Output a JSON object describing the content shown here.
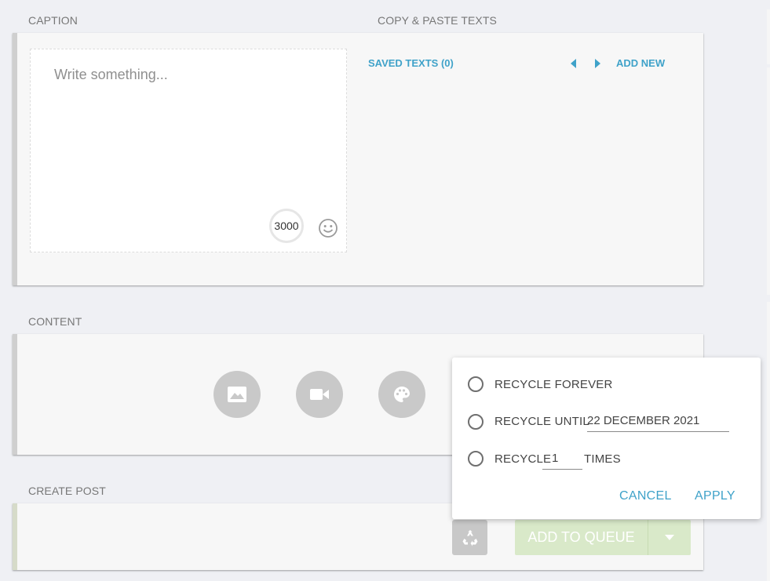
{
  "caption": {
    "section_label": "CAPTION",
    "placeholder": "Write something...",
    "char_count": "3000"
  },
  "copy_paste": {
    "section_label": "COPY & PASTE TEXTS",
    "saved_texts": "SAVED TEXTS (0)",
    "add_new": "ADD NEW"
  },
  "content": {
    "section_label": "CONTENT",
    "buttons": [
      "image-icon",
      "video-camera-icon",
      "palette-icon"
    ]
  },
  "create_post": {
    "section_label": "CREATE POST",
    "add_to_queue": "ADD TO QUEUE"
  },
  "recycle_popup": {
    "forever": "RECYCLE FOREVER",
    "until": "RECYCLE UNTIL",
    "until_date": "22 DECEMBER 2021",
    "times_prefix": "RECYCLE",
    "times_value": "1",
    "times_suffix": "TIMES",
    "cancel": "CANCEL",
    "apply": "APPLY"
  },
  "colors": {
    "accent": "#3fa2c9",
    "background": "#eff0f4",
    "queue_button": "#d9e9c9"
  }
}
